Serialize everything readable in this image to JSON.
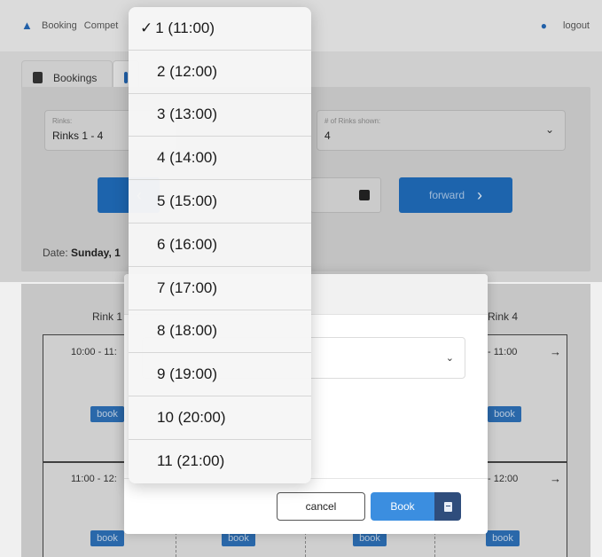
{
  "topnav": {
    "links": [
      "Booking",
      "Compet"
    ],
    "logout": "logout"
  },
  "tabs": [
    {
      "label": "Bookings"
    },
    {
      "label": ""
    }
  ],
  "filters": {
    "rinks_label": "Rinks:",
    "rinks_value": "Rinks 1 - 4",
    "num_label": "# of Rinks shown:",
    "num_value": "4",
    "forward_label": "forward",
    "date_prefix": "Date: ",
    "date_value": "Sunday, 1"
  },
  "grid": {
    "rink_left": "Rink 1",
    "rink_right": "Rink 4",
    "slots": [
      {
        "left_time": "10:00 - 11:",
        "right_time": "- 11:00"
      },
      {
        "left_time": "11:00 - 12:",
        "right_time": "- 12:00"
      }
    ],
    "book_label": "book"
  },
  "modal": {
    "cancel_label": "cancel",
    "book_label": "Book"
  },
  "picker": {
    "options": [
      {
        "label": "1 (11:00)",
        "selected": true
      },
      {
        "label": "2 (12:00)",
        "selected": false
      },
      {
        "label": "3 (13:00)",
        "selected": false
      },
      {
        "label": "4 (14:00)",
        "selected": false
      },
      {
        "label": "5 (15:00)",
        "selected": false
      },
      {
        "label": "6 (16:00)",
        "selected": false
      },
      {
        "label": "7 (17:00)",
        "selected": false
      },
      {
        "label": "8 (18:00)",
        "selected": false
      },
      {
        "label": "9 (19:00)",
        "selected": false
      },
      {
        "label": "10 (20:00)",
        "selected": false
      },
      {
        "label": "11 (21:00)",
        "selected": false
      }
    ],
    "check_mark": "✓"
  },
  "colors": {
    "primary": "#1f6bb8",
    "book_button": "#3b8ee0",
    "book_icon_bg": "#2f4d7c"
  }
}
